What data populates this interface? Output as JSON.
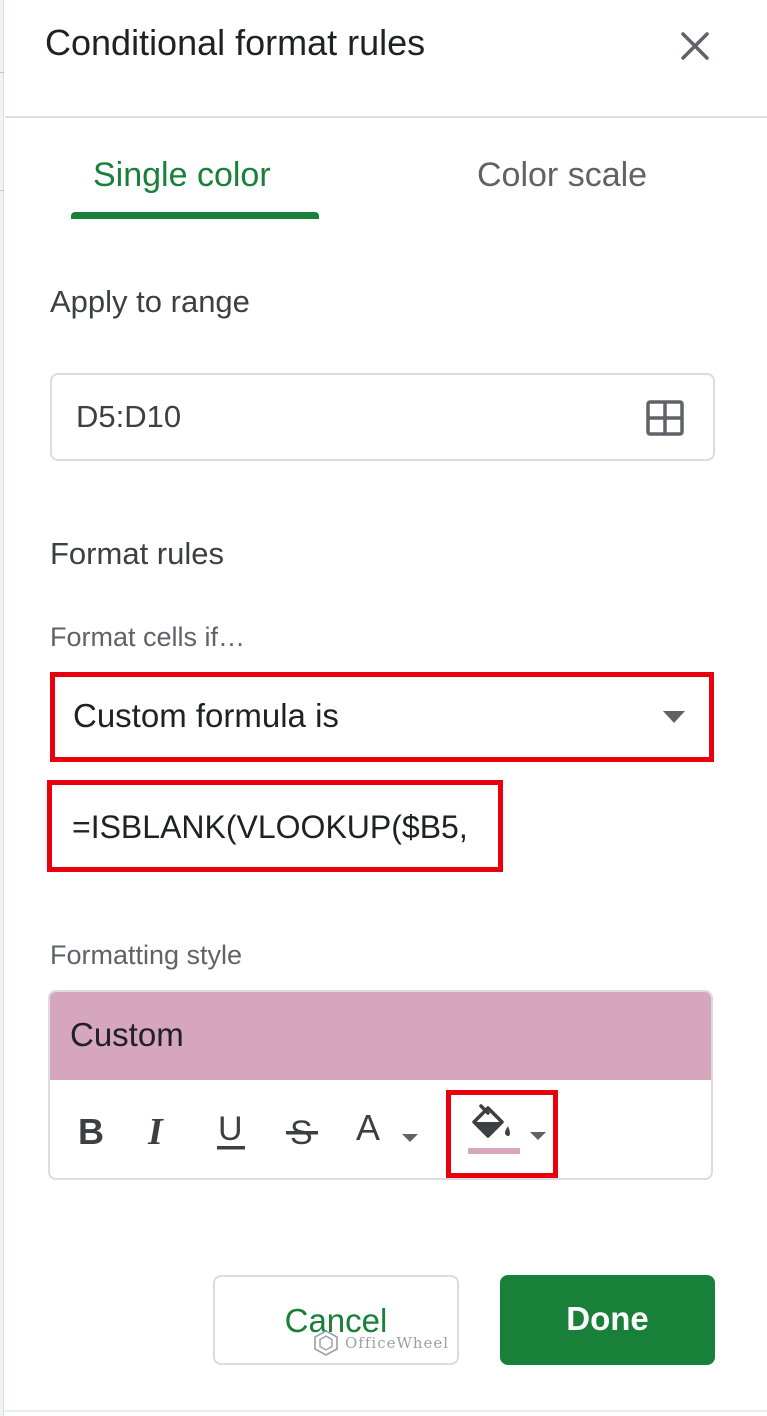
{
  "panel": {
    "title": "Conditional format rules",
    "close_icon": "close-icon"
  },
  "tabs": [
    {
      "label": "Single color",
      "active": true
    },
    {
      "label": "Color scale",
      "active": false
    }
  ],
  "apply_to_range": {
    "label": "Apply to range",
    "value": "D5:D10",
    "icon": "grid-select-icon"
  },
  "format_rules": {
    "label": "Format rules",
    "condition_label": "Format cells if…",
    "condition_value": "Custom formula is",
    "formula_value": "=ISBLANK(VLOOKUP($B5,"
  },
  "formatting_style": {
    "label": "Formatting style",
    "preview_text": "Custom",
    "preview_color": "#d5a6bd",
    "toolbar": [
      {
        "label": "B",
        "icon": "bold-icon"
      },
      {
        "label": "I",
        "icon": "italic-icon"
      },
      {
        "label": "U",
        "icon": "underline-icon"
      },
      {
        "label": "S",
        "icon": "strikethrough-icon"
      },
      {
        "label": "A",
        "icon": "text-color-icon"
      },
      {
        "icon": "fill-color-icon"
      }
    ]
  },
  "actions": {
    "cancel_label": "Cancel",
    "done_label": "Done"
  },
  "watermark": {
    "text": "OfficeWheel"
  },
  "colors": {
    "accent_green": "#188038",
    "highlight_red": "#e8000c",
    "border_gray": "#dadce0"
  }
}
